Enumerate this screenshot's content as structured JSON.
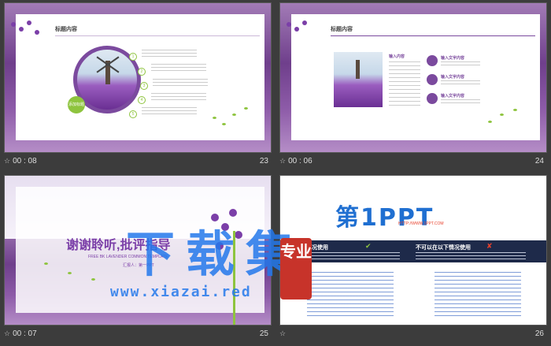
{
  "slides": [
    {
      "title": "标题内容",
      "badge": "添加标题",
      "steps": [
        "1",
        "2",
        "3",
        "4",
        "5"
      ],
      "time": "00 : 08",
      "number": "23"
    },
    {
      "title": "标题内容",
      "left_label": "输入内容",
      "right_labels": [
        "输入文字内容",
        "输入文字内容",
        "输入文字内容"
      ],
      "time": "00 : 06",
      "number": "24"
    },
    {
      "heading": "谢谢聆听,批评指导",
      "subtitle": "FREE BK LAVENDER COMMON TEMPLATE",
      "reporter": "汇报人：第一PPT",
      "time": "00 : 07",
      "number": "25"
    },
    {
      "logo_main": "第1PPT",
      "logo_url": "HTTP://WWW.1PPT.COM",
      "allowed_head": "在下列情况使用",
      "disallowed_head": "不可以在以下情况使用",
      "time": "",
      "number": "26"
    }
  ],
  "watermark": {
    "text": "下载集",
    "url": "www.xiazai.red",
    "seal": "专业"
  },
  "colors": {
    "background": "#3c3c3c",
    "accent_purple": "#7b4a9e",
    "logo_blue": "#1f6fd1",
    "logo_red": "#e8412c",
    "navy_band": "#1e2a4a",
    "green": "#8ec43e"
  }
}
